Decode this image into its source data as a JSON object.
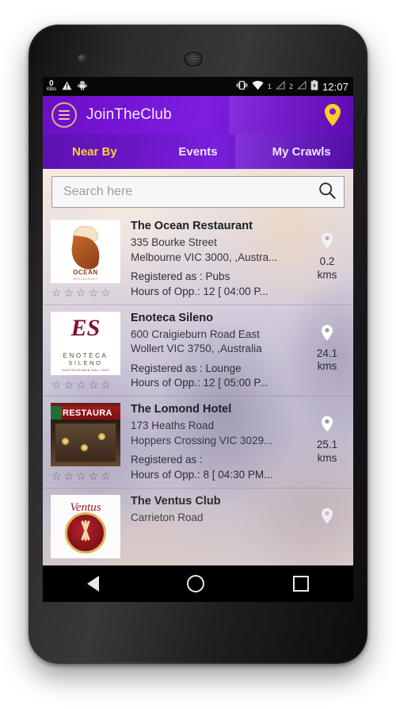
{
  "status_bar": {
    "net_speed_value": "0",
    "net_speed_unit": "KB/s",
    "warning_icon": "warning-triangle-icon",
    "android_icon": "android-robot-icon",
    "vibrate_icon": "vibrate-icon",
    "wifi_icon": "wifi-icon",
    "sim1_label": "1",
    "sim2_label": "2",
    "battery_icon": "battery-charging-icon",
    "clock": "12:07"
  },
  "app_bar": {
    "menu_icon": "hamburger-menu-icon",
    "title": "JoinTheClub",
    "location_icon": "location-pin-icon",
    "accent_color": "#7c1ee0",
    "highlight_color": "#ffd233"
  },
  "tabs": [
    {
      "label": "Near By",
      "active": true
    },
    {
      "label": "Events",
      "active": false
    },
    {
      "label": "My Crawls",
      "active": false
    }
  ],
  "search": {
    "placeholder": "Search here",
    "value": "",
    "icon": "search-icon"
  },
  "venues": [
    {
      "name": "The Ocean Restaurant",
      "address_line1": "335 Bourke Street",
      "address_line2": "Melbourne VIC 3000, ,Austra...",
      "registered_as": "Registered as : Pubs",
      "hours": "Hours of Opp.: 12 [ 04:00 P...",
      "distance": "0.2",
      "distance_unit": "kms",
      "rating": 0,
      "logo": "ocean-restaurant-logo"
    },
    {
      "name": "Enoteca Sileno",
      "address_line1": "600 Craigieburn Road East",
      "address_line2": "Wollert VIC 3750, ,Australia",
      "registered_as": "Registered as : Lounge",
      "hours": "Hours of Opp.: 12 [ 05:00 P...",
      "distance": "24.1",
      "distance_unit": "kms",
      "rating": 0,
      "logo": "enoteca-sileno-logo"
    },
    {
      "name": "The Lomond Hotel",
      "address_line1": "173 Heaths Road",
      "address_line2": " Hoppers Crossing VIC 3029...",
      "registered_as": "Registered as :",
      "hours": "Hours of Opp.: 8 [ 04:30 PM...",
      "distance": "25.1",
      "distance_unit": "kms",
      "rating": 0,
      "logo": "lomond-hotel-photo"
    },
    {
      "name": "The Ventus Club",
      "address_line1": "Carrieton Road",
      "address_line2": "",
      "registered_as": "",
      "hours": "",
      "distance": "",
      "distance_unit": "",
      "rating": 0,
      "logo": "ventus-club-logo"
    }
  ],
  "star_glyph": "☆",
  "nav_bar": {
    "back_icon": "back-triangle-icon",
    "home_icon": "home-circle-icon",
    "recents_icon": "recents-square-icon"
  }
}
